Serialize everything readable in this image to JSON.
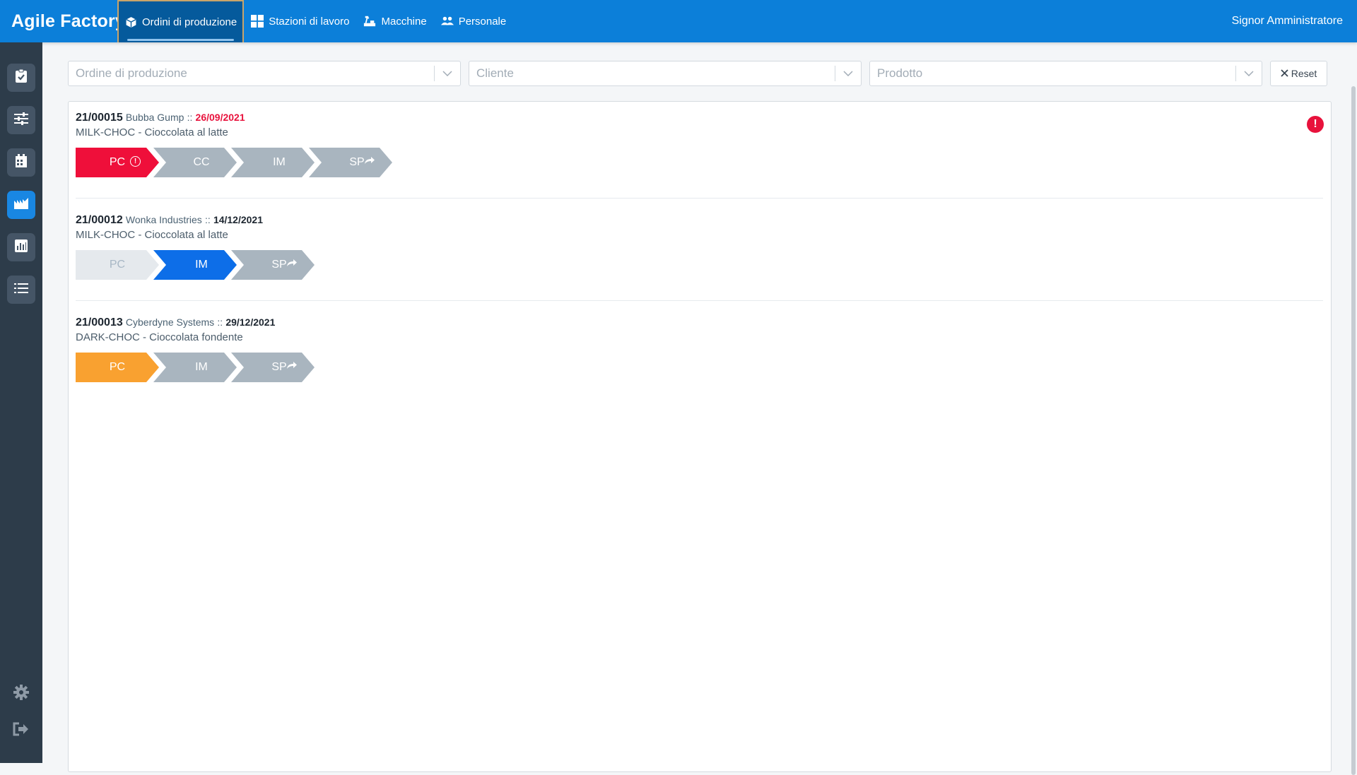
{
  "app": {
    "title": "Agile Factory"
  },
  "nav": {
    "items": [
      {
        "label": "Ordini di produzione",
        "icon": "cube-icon",
        "active": true
      },
      {
        "label": "Stazioni di lavoro",
        "icon": "grid-icon",
        "active": false
      },
      {
        "label": "Macchine",
        "icon": "machine-icon",
        "active": false
      },
      {
        "label": "Personale",
        "icon": "people-icon",
        "active": false
      }
    ],
    "user": "Signor Amministratore"
  },
  "sidebar": {
    "items": [
      {
        "icon": "clipboard-check-icon",
        "active": false
      },
      {
        "icon": "sliders-icon",
        "active": false
      },
      {
        "icon": "calendar-icon",
        "active": false
      },
      {
        "icon": "factory-icon",
        "active": true
      },
      {
        "icon": "chart-icon",
        "active": false
      },
      {
        "icon": "list-icon",
        "active": false
      }
    ],
    "bottom": [
      {
        "icon": "gear-icon"
      },
      {
        "icon": "logout-icon"
      }
    ]
  },
  "filters": {
    "order_placeholder": "Ordine di produzione",
    "client_placeholder": "Cliente",
    "product_placeholder": "Prodotto",
    "reset_label": "Reset"
  },
  "orders": [
    {
      "code": "21/00015",
      "client": "Bubba Gump",
      "separator": "::",
      "date": "26/09/2021",
      "date_late": true,
      "product": "MILK-CHOC - Cioccolata al latte",
      "alert": true,
      "steps": [
        {
          "label": "PC",
          "state": "error",
          "badge": "!"
        },
        {
          "label": "CC",
          "state": "pending"
        },
        {
          "label": "IM",
          "state": "pending"
        },
        {
          "label": "SP",
          "state": "pending",
          "share": true
        }
      ]
    },
    {
      "code": "21/00012",
      "client": "Wonka Industries",
      "separator": "::",
      "date": "14/12/2021",
      "date_late": false,
      "product": "MILK-CHOC - Cioccolata al latte",
      "alert": false,
      "steps": [
        {
          "label": "PC",
          "state": "done"
        },
        {
          "label": "IM",
          "state": "active"
        },
        {
          "label": "SP",
          "state": "pending",
          "share": true
        }
      ]
    },
    {
      "code": "21/00013",
      "client": "Cyberdyne Systems",
      "separator": "::",
      "date": "29/12/2021",
      "date_late": false,
      "product": "DARK-CHOC - Cioccolata fondente",
      "alert": false,
      "steps": [
        {
          "label": "PC",
          "state": "warning"
        },
        {
          "label": "IM",
          "state": "pending"
        },
        {
          "label": "SP",
          "state": "pending",
          "share": true
        }
      ]
    }
  ],
  "colors": {
    "topbar": "#0c7fd9",
    "sidebar": "#2d3c4a",
    "error": "#ef0f3a",
    "active": "#0d6ee8",
    "warning": "#f9a130",
    "pending": "#a9b5bf",
    "done": "#e5e9ed"
  }
}
